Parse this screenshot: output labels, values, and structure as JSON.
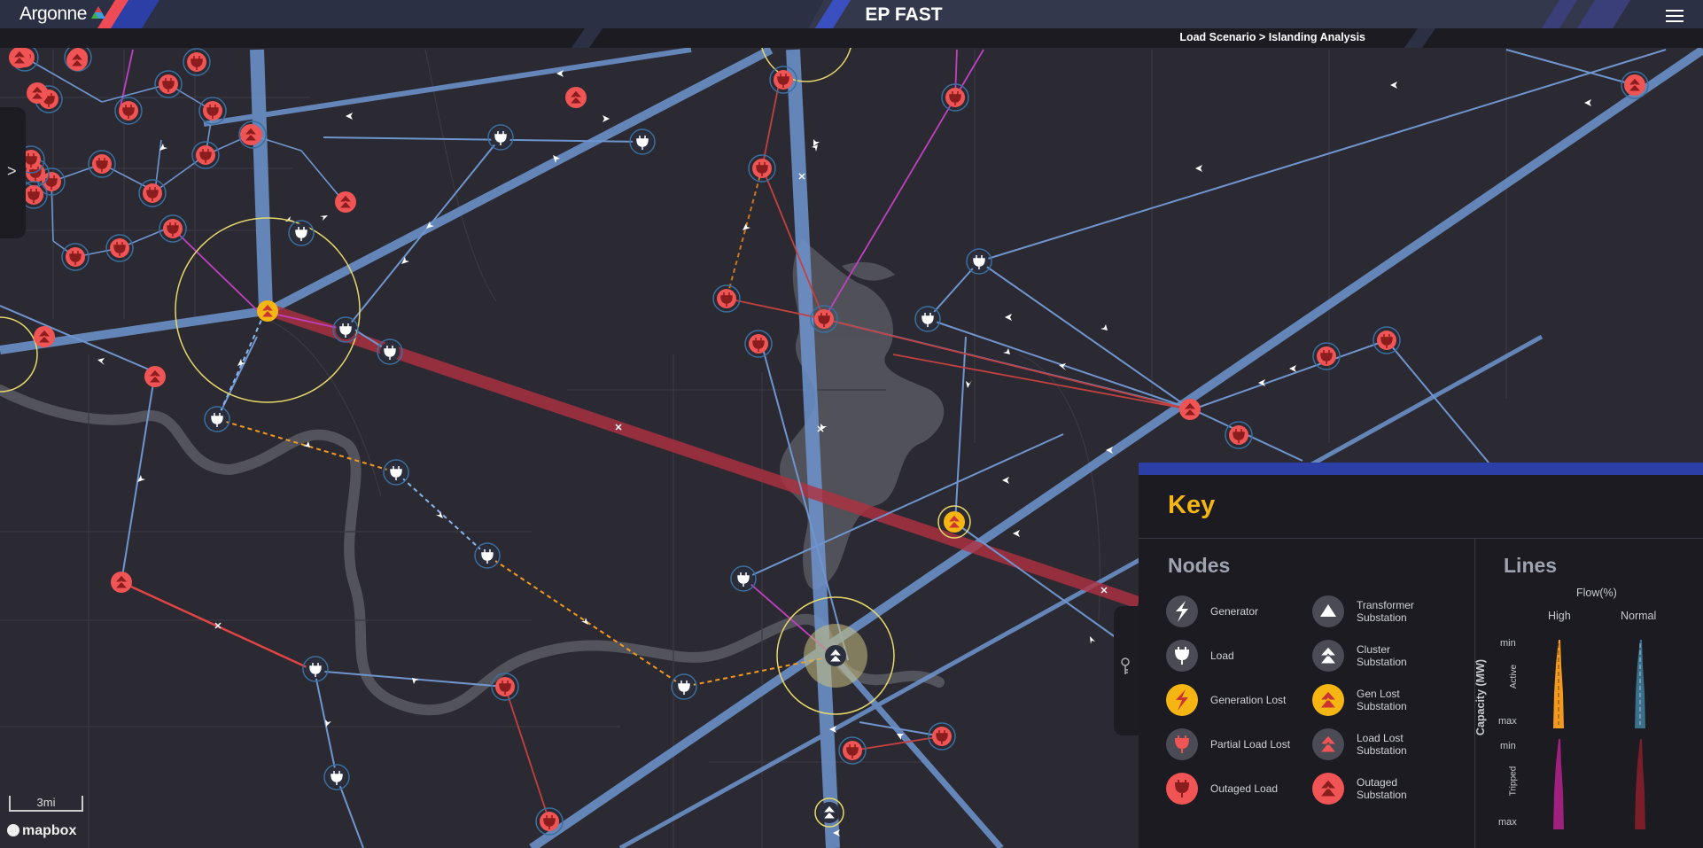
{
  "header": {
    "logo_text": "Argonne",
    "app_title": "EP FAST",
    "breadcrumb": "Load Scenario > Islanding Analysis"
  },
  "sidebar_toggle": ">",
  "key_toggle_icon": "key-icon",
  "scale_label": "3mi",
  "attribution": "mapbox",
  "key": {
    "title": "Key",
    "nodes_title": "Nodes",
    "lines_title": "Lines",
    "nodes": [
      {
        "label": "Generator",
        "icon": "generator-icon"
      },
      {
        "label": "Load",
        "icon": "load-icon"
      },
      {
        "label": "Generation Lost",
        "icon": "generation-lost-icon"
      },
      {
        "label": "Partial Load Lost",
        "icon": "partial-load-lost-icon"
      },
      {
        "label": "Outaged Load",
        "icon": "outaged-load-icon"
      },
      {
        "label": "Transformer Substation",
        "icon": "transformer-substation-icon"
      },
      {
        "label": "Cluster Substation",
        "icon": "cluster-substation-icon"
      },
      {
        "label": "Gen Lost Substation",
        "icon": "gen-lost-substation-icon"
      },
      {
        "label": "Load Lost Substation",
        "icon": "load-lost-substation-icon"
      },
      {
        "label": "Outaged Substation",
        "icon": "outaged-substation-icon"
      }
    ],
    "lines": {
      "flow_label": "Flow(%)",
      "high_label": "High",
      "normal_label": "Normal",
      "capacity_label": "Capacity (MW)",
      "active_label": "Active",
      "tripped_label": "Tripped",
      "min_label": "min",
      "max_label": "max"
    }
  },
  "colors": {
    "background": "#2b2a33",
    "header": "#1b1b21",
    "accent_orange": "#f5b613",
    "outaged_red": "#f05454",
    "line_blue": "#6f95cf",
    "tripped_red": "#b03040",
    "magenta": "#c040c0",
    "panel_bar": "#2c3fa6"
  }
}
